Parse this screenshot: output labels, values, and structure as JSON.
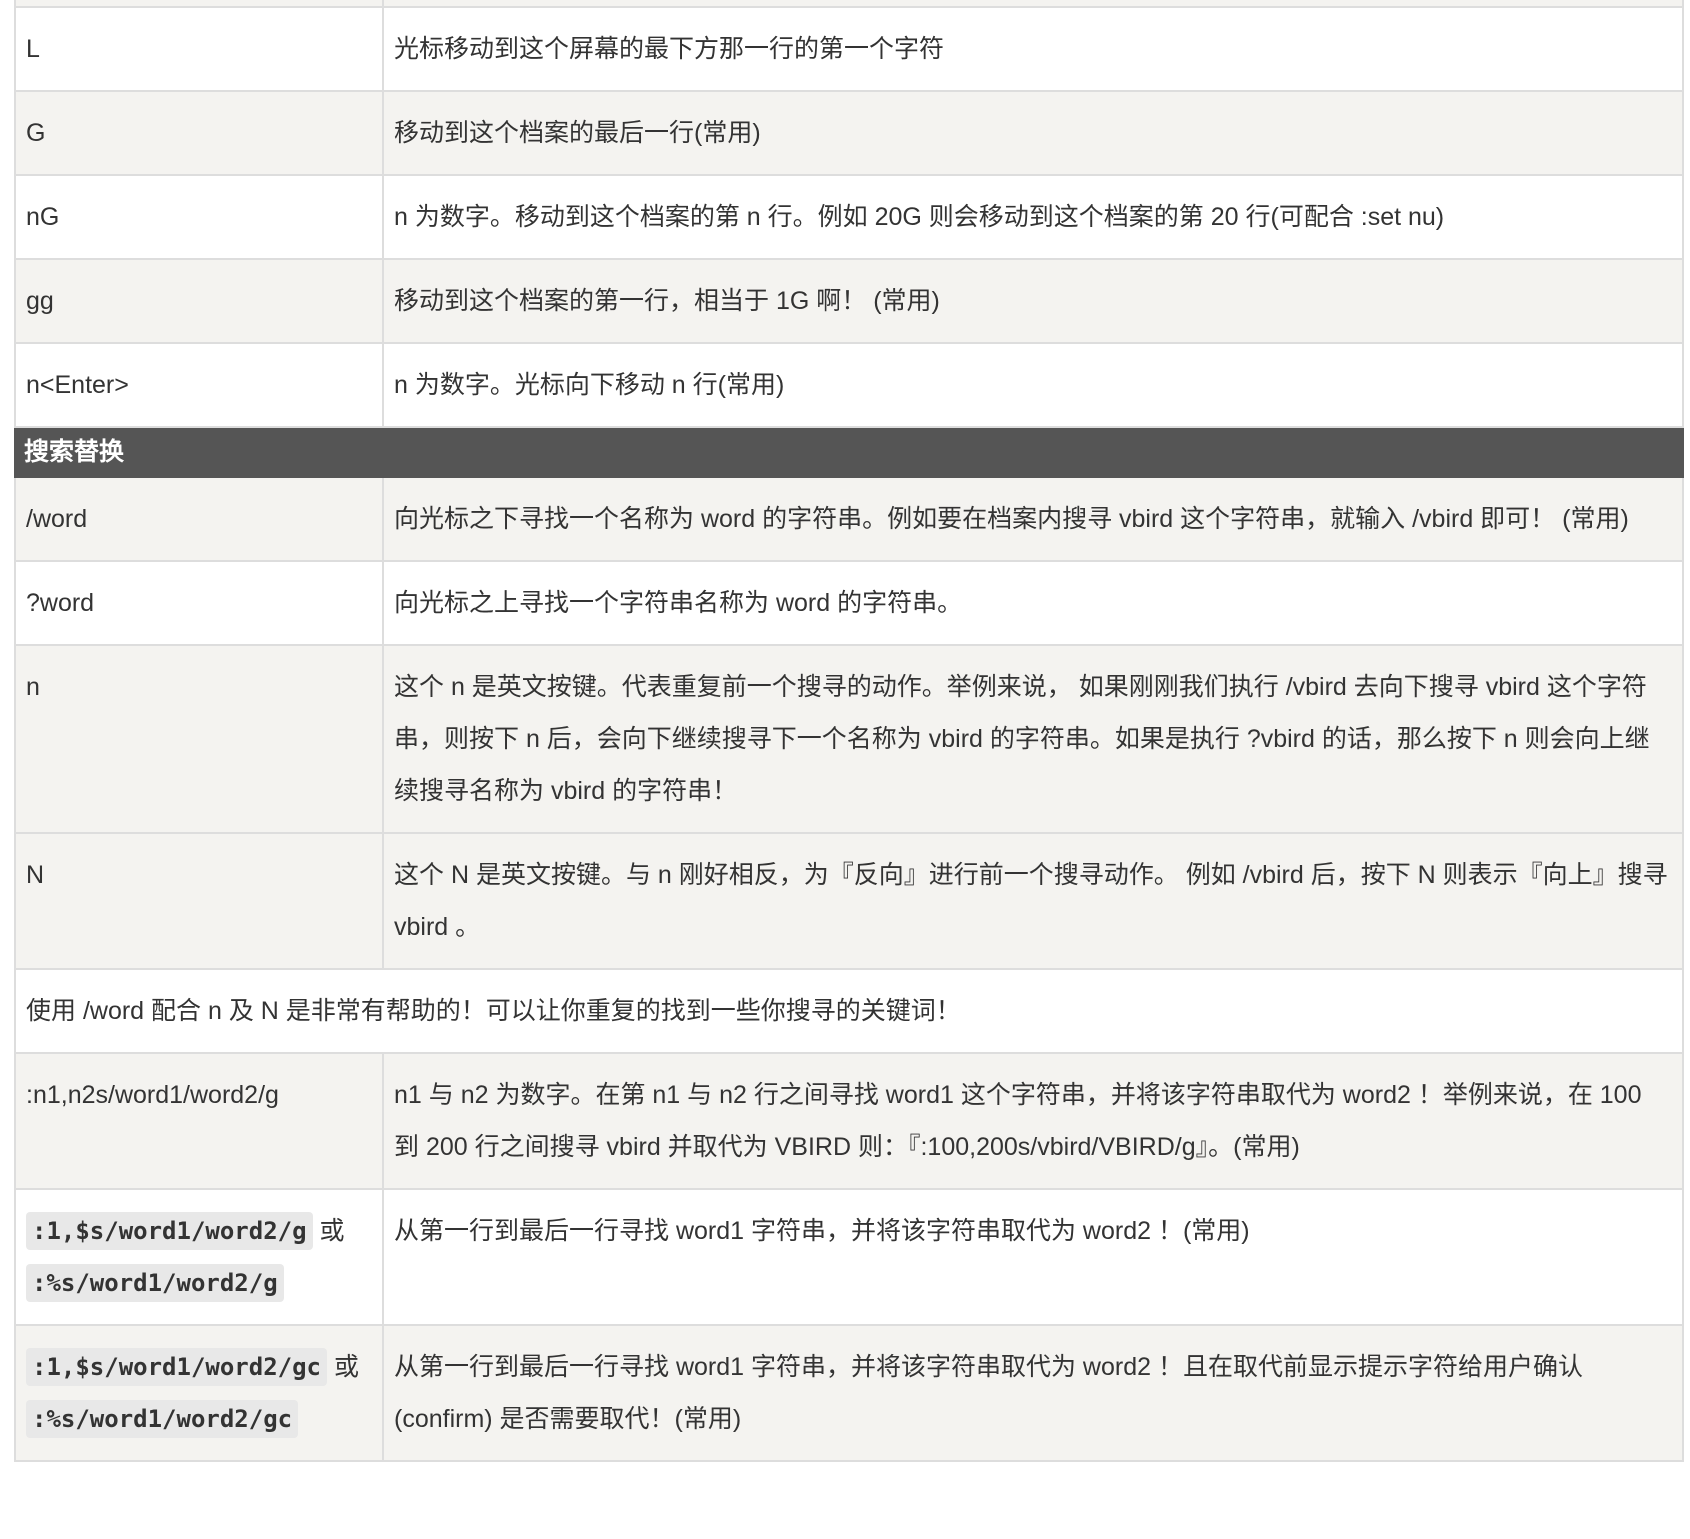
{
  "motion_rows": [
    {
      "key": "L",
      "desc": "光标移动到这个屏幕的最下方那一行的第一个字符"
    },
    {
      "key": "G",
      "desc": "移动到这个档案的最后一行(常用)"
    },
    {
      "key": "nG",
      "desc": "n 为数字。移动到这个档案的第 n 行。例如 20G 则会移动到这个档案的第 20 行(可配合 :set nu)"
    },
    {
      "key": "gg",
      "desc": "移动到这个档案的第一行，相当于 1G 啊！ (常用)"
    },
    {
      "key": "n<Enter>",
      "desc": "n 为数字。光标向下移动 n 行(常用)"
    }
  ],
  "section_title": "搜索替换",
  "search_rows": [
    {
      "key": "/word",
      "desc": "向光标之下寻找一个名称为 word 的字符串。例如要在档案内搜寻 vbird 这个字符串，就输入 /vbird 即可！ (常用)"
    },
    {
      "key": "?word",
      "desc": "向光标之上寻找一个字符串名称为 word 的字符串。"
    },
    {
      "key": "n",
      "desc": "这个 n 是英文按键。代表重复前一个搜寻的动作。举例来说， 如果刚刚我们执行 /vbird 去向下搜寻 vbird 这个字符串，则按下 n 后，会向下继续搜寻下一个名称为 vbird 的字符串。如果是执行 ?vbird 的话，那么按下 n 则会向上继续搜寻名称为 vbird 的字符串！"
    },
    {
      "key": "N",
      "desc": "这个 N 是英文按键。与 n 刚好相反，为『反向』进行前一个搜寻动作。 例如 /vbird 后，按下 N 则表示『向上』搜寻 vbird 。"
    }
  ],
  "note": "使用 /word 配合 n 及 N 是非常有帮助的！可以让你重复的找到一些你搜寻的关键词！",
  "replace_row": {
    "key": ":n1,n2s/word1/word2/g",
    "desc": "n1 与 n2 为数字。在第 n1 与 n2 行之间寻找 word1 这个字符串，并将该字符串取代为 word2 ！举例来说，在 100 到 200 行之间搜寻 vbird 并取代为 VBIRD 则：『:100,200s/vbird/VBIRD/g』。(常用)"
  },
  "global_rows": [
    {
      "code1": ":1,$s/word1/word2/g",
      "or": "或",
      "code2": ":%s/word1/word2/g",
      "desc": "从第一行到最后一行寻找 word1 字符串，并将该字符串取代为 word2 ！(常用)"
    },
    {
      "code1": ":1,$s/word1/word2/gc",
      "or": "或",
      "code2": ":%s/word1/word2/gc",
      "desc": "从第一行到最后一行寻找 word1 字符串，并将该字符串取代为 word2 ！且在取代前显示提示字符给用户确认 (confirm) 是否需要取代！(常用)"
    }
  ]
}
